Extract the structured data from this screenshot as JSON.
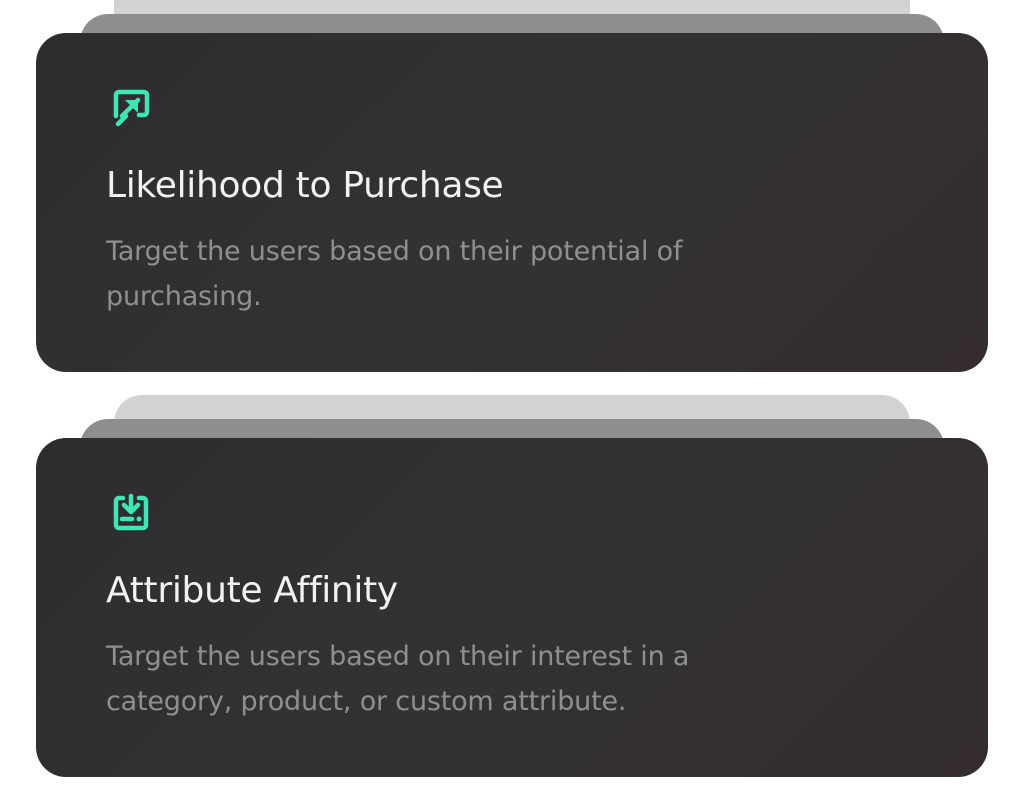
{
  "cards": [
    {
      "icon": "cast-cursor-icon",
      "title": "Likelihood to Purchase",
      "description": "Target the users based on their potential of purchasing."
    },
    {
      "icon": "download-tray-icon",
      "title": "Attribute Affinity",
      "description": "Target the users based on their interest in a category, product, or custom attribute."
    }
  ],
  "colors": {
    "accent": "#3ee6b5",
    "card_background": "#313133",
    "title_text": "#f2f2f2",
    "description_text": "#8f8f91"
  }
}
